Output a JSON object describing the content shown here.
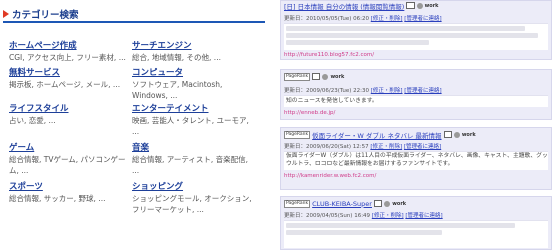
{
  "category_panel": {
    "title": "カテゴリー検索",
    "categories": [
      {
        "name": "ホームページ作成",
        "desc": [
          "CGI, アクセス向上, フリー素材, ..."
        ]
      },
      {
        "name": "サーチエンジン",
        "desc": [
          "総合, 地域情報, その他, ..."
        ]
      },
      {
        "name": "無料サービス",
        "desc": [
          "掲示板, ホームページ, メール, ..."
        ]
      },
      {
        "name": "コンピュータ",
        "desc": [
          "ソフトウェア, Macintosh,",
          "Windows, ..."
        ]
      },
      {
        "name": "ライフスタイル",
        "desc": [
          "占い, 恋愛, ..."
        ]
      },
      {
        "name": "エンターテイメント",
        "desc": [
          "映画, 芸能人・タレント, ユーモア,",
          "..."
        ]
      },
      {
        "name": "ゲーム",
        "desc": [
          "総合情報, TVゲーム, パソコンゲー",
          "ム, ..."
        ]
      },
      {
        "name": "音楽",
        "desc": [
          "総合情報, アーティスト, 音楽配信,",
          "..."
        ]
      },
      {
        "name": "スポーツ",
        "desc": [
          "総合情報, サッカー, 野球, ..."
        ]
      },
      {
        "name": "ショッピング",
        "desc": [
          "ショッピングモール, オークション,",
          "フリーマーケット, ..."
        ]
      }
    ]
  },
  "listing": {
    "entries": [
      {
        "title": "[日] 日本情報 自分の情報 (情報閲覧情報)",
        "meta_date": "更新日：2010/05/05(Tue) 06:20",
        "meta_links": [
          "[修正・削除]",
          "[管理者に連絡]"
        ],
        "body_lines": [],
        "url": "http://future110.blog57.fc2.com/",
        "work": "work"
      },
      {
        "title": "",
        "meta_date": "更新日：2009/06/23(Tue) 22:30",
        "meta_links": [
          "[修正・削除]",
          "[管理者に連絡]"
        ],
        "body_lines": [
          "知のニュースを発信していきます。"
        ],
        "url": "http://enneb.de.jp/",
        "work": "work"
      },
      {
        "title": "仮面ライダー・W ダブル ネタバレ 最新情報",
        "meta_date": "更新日：2009/06/20(Sat) 12:57",
        "meta_links": [
          "[修正・削除]",
          "[管理者に連絡]"
        ],
        "body_lines": [
          "仮面ライダーW（ダブル）は11人目の平成仮面ライダー、ネタバレ、画像、キャスト、主題歌、グッズ、全",
          "ウルトラ、ロコロなど最新情報をお届けするファンサイトです。"
        ],
        "url": "http://kamenrider.w.web.fc2.com/",
        "work": "work"
      },
      {
        "title": "CLUB-KEIBA-Super",
        "meta_date": "更新日：2009/04/05(Sun) 16:49",
        "meta_links": [
          "[修正・削除]",
          "[管理者に連絡]"
        ],
        "body_lines": [],
        "url": "",
        "work": "work"
      }
    ]
  }
}
